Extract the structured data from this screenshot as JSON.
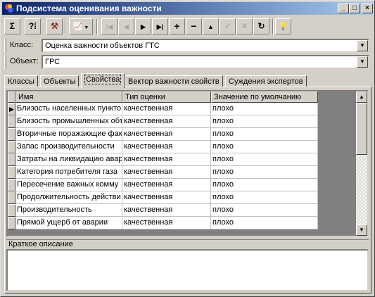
{
  "window": {
    "title": "Подсистема оценивания важности"
  },
  "toolbar": {
    "buttons": [
      {
        "icon": "sigma-icon",
        "glyph": "Σ"
      },
      {
        "icon": "help-query-icon",
        "glyph": "?⁞"
      },
      {
        "icon": "expert-tool-icon",
        "glyph": "⚒"
      },
      {
        "icon": "chart-icon",
        "glyph": "📈"
      },
      {
        "icon": "first-record-icon",
        "glyph": "|◀"
      },
      {
        "icon": "prev-record-icon",
        "glyph": "◀"
      },
      {
        "icon": "next-record-icon",
        "glyph": "▶"
      },
      {
        "icon": "last-record-icon",
        "glyph": "▶|"
      },
      {
        "icon": "add-record-icon",
        "glyph": "+"
      },
      {
        "icon": "delete-record-icon",
        "glyph": "−"
      },
      {
        "icon": "edit-record-icon",
        "glyph": "▲"
      },
      {
        "icon": "post-record-icon",
        "glyph": "✓"
      },
      {
        "icon": "cancel-edit-icon",
        "glyph": "✕"
      },
      {
        "icon": "refresh-icon",
        "glyph": "↻"
      },
      {
        "icon": "lightbulb-icon",
        "glyph": "💡"
      }
    ]
  },
  "class_field": {
    "label": "Класс:",
    "value": "Оценка важности объектов ГТС"
  },
  "object_field": {
    "label": "Объект:",
    "value": "ГРС"
  },
  "tabs": [
    "Классы",
    "Объекты",
    "Свойства",
    "Вектор важности свойств",
    "Суждения экспертов"
  ],
  "active_tab": 2,
  "grid": {
    "columns": [
      "Имя",
      "Тип оценки",
      "Значение по умолчанию"
    ],
    "rows": [
      [
        "Близость населенных пункто",
        "качественная",
        "плохо"
      ],
      [
        "Близость промышленных объ",
        "качественная",
        "плохо"
      ],
      [
        "Вторичные поражающие фак",
        "качественная",
        "плохо"
      ],
      [
        "Запас производительности",
        "качественная",
        "плохо"
      ],
      [
        "Затраты на ликвидацию авар",
        "качественная",
        "плохо"
      ],
      [
        "Категория потребителя газа",
        "качественная",
        "плохо"
      ],
      [
        "Пересечение важных комму",
        "качественная",
        "плохо"
      ],
      [
        "Продолжительность действи",
        "качественная",
        "плохо"
      ],
      [
        "Производительность",
        "качественная",
        "плохо"
      ],
      [
        "Прямой ущерб от аварии",
        "качественная",
        "плохо"
      ]
    ],
    "current_row_marker": "▶"
  },
  "description": {
    "label": "Краткое описание",
    "text": ""
  }
}
